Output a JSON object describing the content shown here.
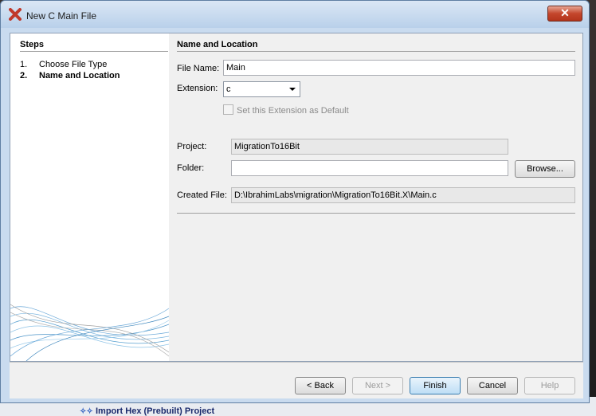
{
  "window": {
    "title": "New C Main File",
    "close_label": "✕"
  },
  "steps": {
    "title": "Steps",
    "items": [
      {
        "num": "1.",
        "label": "Choose File Type"
      },
      {
        "num": "2.",
        "label": "Name and Location"
      }
    ]
  },
  "main": {
    "section_title": "Name and Location",
    "file_name_label": "File Name:",
    "file_name_value": "Main",
    "extension_label": "Extension:",
    "extension_value": "c",
    "default_ext_label": "Set this Extension as Default",
    "project_label": "Project:",
    "project_value": "MigrationTo16Bit",
    "folder_label": "Folder:",
    "folder_value": "",
    "browse_label": "Browse...",
    "created_file_label": "Created File:",
    "created_file_value": "D:\\IbrahimLabs\\migration\\MigrationTo16Bit.X\\Main.c"
  },
  "footer": {
    "back_label": "< Back",
    "next_label": "Next >",
    "finish_label": "Finish",
    "cancel_label": "Cancel",
    "help_label": "Help"
  },
  "background": {
    "bottom_item": "Import Hex (Prebuilt) Project"
  }
}
